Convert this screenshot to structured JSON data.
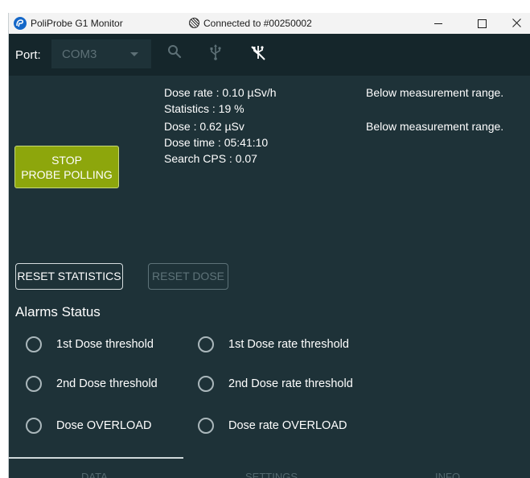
{
  "window": {
    "title": "PoliProbe G1 Monitor",
    "connection_status": "Connected to #00250002"
  },
  "toolbar": {
    "port_label": "Port:",
    "port_value": "COM3"
  },
  "readings": {
    "dose_rate": "Dose rate :  0.10 µSv/h",
    "statistics": "Statistics : 19 %",
    "dose": "Dose :  0.62 µSv",
    "dose_time": "Dose time : 05:41:10",
    "search_cps": "Search CPS : 0.07",
    "dose_rate_note": "Below measurement range.",
    "dose_note": "Below measurement range."
  },
  "buttons": {
    "stop_line1": "STOP",
    "stop_line2": "PROBE POLLING",
    "reset_statistics": "RESET STATISTICS",
    "reset_dose": "RESET DOSE"
  },
  "alarms": {
    "title": "Alarms Status",
    "items": [
      {
        "label": "1st Dose threshold"
      },
      {
        "label": "1st Dose rate threshold"
      },
      {
        "label": "2nd Dose threshold"
      },
      {
        "label": "2nd Dose rate threshold"
      },
      {
        "label": "Dose OVERLOAD"
      },
      {
        "label": "Dose rate OVERLOAD"
      }
    ]
  },
  "tabs": [
    {
      "label": "DATA"
    },
    {
      "label": "SETTINGS"
    },
    {
      "label": "INFO"
    }
  ],
  "colors": {
    "background": "#1e3238",
    "toolbar": "#15262b",
    "accent_button": "#8da60c",
    "disabled": "#5e7379"
  }
}
